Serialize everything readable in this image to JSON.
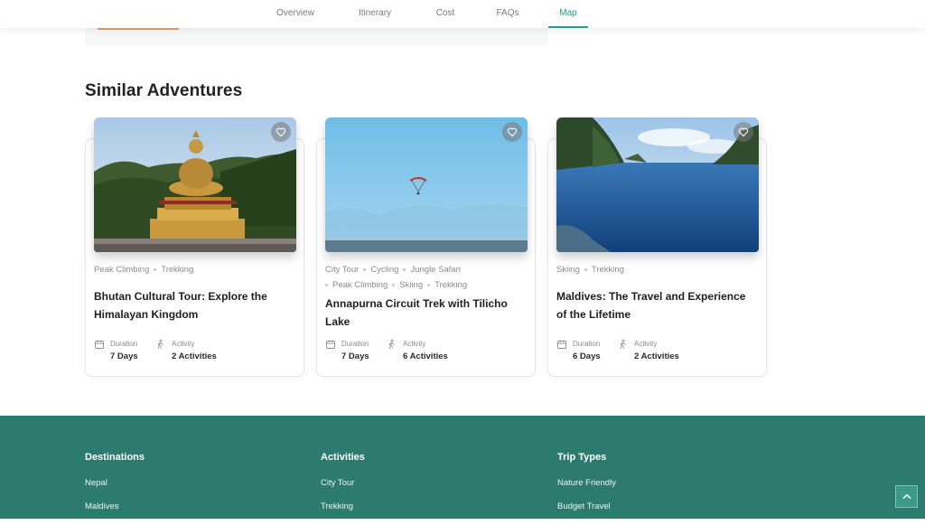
{
  "tabs": [
    {
      "label": "Overview",
      "active": false
    },
    {
      "label": "Itinerary",
      "active": false
    },
    {
      "label": "Cost",
      "active": false
    },
    {
      "label": "FAQs",
      "active": false
    },
    {
      "label": "Map",
      "active": true
    }
  ],
  "accent_color": "#2a9d8f",
  "footer_color": "#2d7a6e",
  "section_title": "Similar Adventures",
  "cards": [
    {
      "tags": [
        "Peak Climbing",
        "Trekking"
      ],
      "title": "Bhutan Cultural Tour: Explore the Himalayan Kingdom",
      "duration_label": "Duration",
      "duration_value": "7 Days",
      "activity_label": "Activity",
      "activity_value": "2 Activities",
      "image": "buddha-statue-photo"
    },
    {
      "tags": [
        "City Tour",
        "Cycling",
        "Jungle Safari",
        "Peak Climbing",
        "Skiing",
        "Trekking"
      ],
      "title": "Annapurna Circuit Trek with Tilicho Lake",
      "duration_label": "Duration",
      "duration_value": "7 Days",
      "activity_label": "Activity",
      "activity_value": "6 Activities",
      "image": "paraglider-sky-photo"
    },
    {
      "tags": [
        "Skiing",
        "Trekking"
      ],
      "title": "Maldives: The Travel and Experience of the Lifetime",
      "duration_label": "Duration",
      "duration_value": "6 Days",
      "activity_label": "Activity",
      "activity_value": "2 Activities",
      "image": "fjord-lake-photo"
    }
  ],
  "footer": {
    "destinations": {
      "heading": "Destinations",
      "links": [
        "Nepal",
        "Maldives"
      ]
    },
    "activities": {
      "heading": "Activities",
      "links": [
        "City Tour",
        "Trekking"
      ]
    },
    "trip_types": {
      "heading": "Trip Types",
      "links": [
        "Nature Friendly",
        "Budget Travel"
      ]
    }
  },
  "icons": {
    "favorite": "heart-icon",
    "duration": "calendar-icon",
    "activity": "hiker-icon",
    "scroll_top": "chevron-up-icon"
  }
}
